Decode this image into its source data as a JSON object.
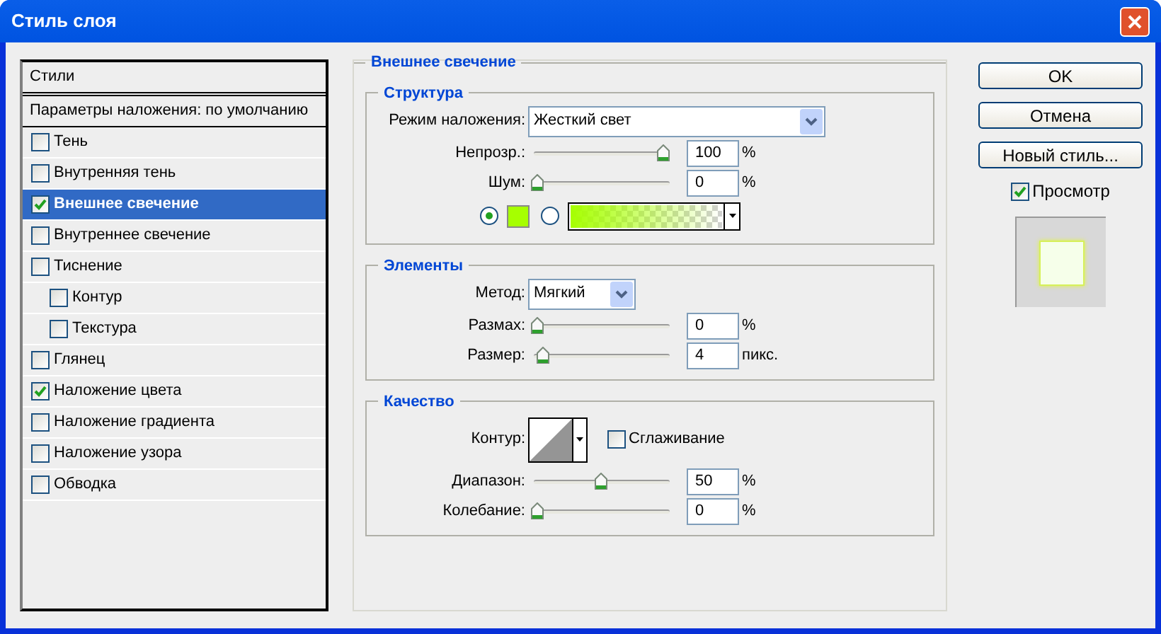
{
  "window": {
    "title": "Стиль слоя"
  },
  "styles_panel": {
    "header": "Стили",
    "blending": "Параметры наложения: по умолчанию",
    "items": [
      {
        "label": "Тень",
        "checked": false,
        "selected": false
      },
      {
        "label": "Внутренняя тень",
        "checked": false,
        "selected": false
      },
      {
        "label": "Внешнее свечение",
        "checked": true,
        "selected": true
      },
      {
        "label": "Внутреннее свечение",
        "checked": false,
        "selected": false
      },
      {
        "label": "Тиснение",
        "checked": false,
        "selected": false,
        "children": [
          {
            "label": "Контур",
            "checked": false,
            "selected": false
          },
          {
            "label": "Текстура",
            "checked": false,
            "selected": false
          }
        ]
      },
      {
        "label": "Глянец",
        "checked": false,
        "selected": false
      },
      {
        "label": "Наложение цвета",
        "checked": true,
        "selected": false
      },
      {
        "label": "Наложение градиента",
        "checked": false,
        "selected": false
      },
      {
        "label": "Наложение узора",
        "checked": false,
        "selected": false
      },
      {
        "label": "Обводка",
        "checked": false,
        "selected": false
      }
    ]
  },
  "panel": {
    "title": "Внешнее свечение",
    "groups": [
      {
        "title": "Структура",
        "rows": [
          {
            "kind": "select",
            "label": "Режим наложения:",
            "value": "Жесткий свет",
            "wide": true
          },
          {
            "kind": "slider",
            "label": "Непрозр.:",
            "level": 1,
            "value": "100",
            "unit": "%"
          },
          {
            "kind": "slider",
            "label": "Шум:",
            "level": 0,
            "value": "0",
            "unit": "%"
          },
          {
            "kind": "fill",
            "options": [
              {
                "kind": "color",
                "selected": true,
                "color": "#a6ff00"
              },
              {
                "kind": "gradient",
                "selected": false,
                "color": "#a6ff00"
              }
            ]
          }
        ]
      },
      {
        "title": "Элементы",
        "rows": [
          {
            "kind": "select",
            "label": "Метод:",
            "value": "Мягкий",
            "wide": false
          },
          {
            "kind": "slider",
            "label": "Размах:",
            "level": 0,
            "value": "0",
            "unit": "%"
          },
          {
            "kind": "slider",
            "label": "Размер:",
            "level": 0.04,
            "value": "4",
            "unit": "пикс."
          }
        ]
      },
      {
        "title": "Качество",
        "rows": [
          {
            "kind": "contour",
            "label": "Контур:",
            "option": {
              "label": "Сглаживание",
              "checked": false
            }
          },
          {
            "kind": "slider",
            "label": "Диапазон:",
            "level": 0.5,
            "value": "50",
            "unit": "%"
          },
          {
            "kind": "slider",
            "label": "Колебание:",
            "level": 0,
            "value": "0",
            "unit": "%"
          }
        ]
      }
    ]
  },
  "buttons": [
    "OK",
    "Отмена",
    "Новый стиль..."
  ],
  "preview": {
    "label": "Просмотр",
    "checked": true
  }
}
